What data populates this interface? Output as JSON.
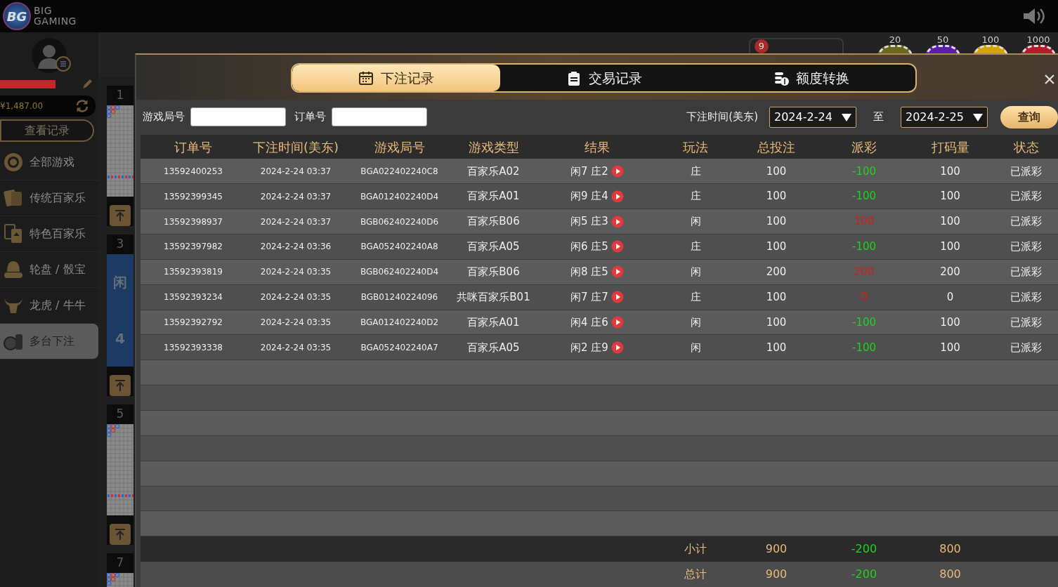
{
  "header": {
    "logo_badge": "BG",
    "logo_line1": "BIG",
    "logo_line2": "GAMING"
  },
  "sidebar": {
    "balance": "¥1,487.00",
    "history_button": "查看记录",
    "items": [
      {
        "label": "全部游戏",
        "kind": "chip",
        "selected": false
      },
      {
        "label": "传统百家乐",
        "kind": "cards",
        "selected": false
      },
      {
        "label": "特色百家乐",
        "kind": "spade",
        "selected": false
      },
      {
        "label": "轮盘 / 骰宝",
        "kind": "dice",
        "selected": false
      },
      {
        "label": "龙虎 / 牛牛",
        "kind": "bull",
        "selected": false
      },
      {
        "label": "多台下注",
        "kind": "stack",
        "selected": true
      }
    ]
  },
  "tables": [
    {
      "number": "1",
      "kind": "road"
    },
    {
      "number": "3",
      "kind": "result",
      "side": "闲",
      "score": "4"
    },
    {
      "number": "5",
      "kind": "road"
    },
    {
      "number": "7",
      "kind": "road"
    }
  ],
  "bet_rack": {
    "count": "9"
  },
  "chips": [
    {
      "label": "20",
      "color": "#6b6a1c"
    },
    {
      "label": "50",
      "color": "#5a1fa8"
    },
    {
      "label": "100",
      "color": "#d4a400"
    },
    {
      "label": "1000",
      "color": "#b51b2c"
    }
  ],
  "modal": {
    "tabs": [
      {
        "label": "下注记录",
        "kind": "calendar",
        "selected": true
      },
      {
        "label": "交易记录",
        "kind": "clipboard",
        "selected": false
      },
      {
        "label": "额度转换",
        "kind": "coins",
        "selected": false
      }
    ],
    "filters": {
      "round_label": "游戏局号",
      "order_label": "订单号",
      "time_label": "下注时间(美东)",
      "from": "2024-2-24",
      "to_label": "至",
      "to": "2024-2-25",
      "query_button": "查询"
    },
    "table": {
      "columns": [
        "订单号",
        "下注时间(美东)",
        "游戏局号",
        "游戏类型",
        "结果",
        "玩法",
        "总投注",
        "派彩",
        "打码量",
        "状态"
      ],
      "rows": [
        {
          "order": "13592400253",
          "time": "2024-2-24 03:37",
          "round": "BGA022402240C8",
          "game": "百家乐A02",
          "result": "闲7 庄2",
          "play": "庄",
          "bet": "100",
          "payout": {
            "value": "-100",
            "color": "#1ed41e"
          },
          "turnover": "100",
          "status": "已派彩"
        },
        {
          "order": "13592399345",
          "time": "2024-2-24 03:37",
          "round": "BGA012402240D4",
          "game": "百家乐A01",
          "result": "闲9 庄4",
          "play": "庄",
          "bet": "100",
          "payout": {
            "value": "-100",
            "color": "#1ed41e"
          },
          "turnover": "100",
          "status": "已派彩"
        },
        {
          "order": "13592398937",
          "time": "2024-2-24 03:37",
          "round": "BGB062402240D6",
          "game": "百家乐B06",
          "result": "闲5 庄3",
          "play": "闲",
          "bet": "100",
          "payout": {
            "value": "100",
            "color": "#d41e1e"
          },
          "turnover": "100",
          "status": "已派彩"
        },
        {
          "order": "13592397982",
          "time": "2024-2-24 03:36",
          "round": "BGA052402240A8",
          "game": "百家乐A05",
          "result": "闲6 庄5",
          "play": "庄",
          "bet": "100",
          "payout": {
            "value": "-100",
            "color": "#1ed41e"
          },
          "turnover": "100",
          "status": "已派彩"
        },
        {
          "order": "13592393819",
          "time": "2024-2-24 03:35",
          "round": "BGB062402240D4",
          "game": "百家乐B06",
          "result": "闲8 庄5",
          "play": "闲",
          "bet": "200",
          "payout": {
            "value": "200",
            "color": "#d41e1e"
          },
          "turnover": "200",
          "status": "已派彩"
        },
        {
          "order": "13592393234",
          "time": "2024-2-24 03:35",
          "round": "BGB01240224096",
          "game": "共咪百家乐B01",
          "result": "闲7 庄7",
          "play": "庄",
          "bet": "100",
          "payout": {
            "value": "0",
            "color": "#d41e1e"
          },
          "turnover": "0",
          "status": "已派彩"
        },
        {
          "order": "13592392792",
          "time": "2024-2-24 03:35",
          "round": "BGA012402240D2",
          "game": "百家乐A01",
          "result": "闲4 庄6",
          "play": "闲",
          "bet": "100",
          "payout": {
            "value": "-100",
            "color": "#1ed41e"
          },
          "turnover": "100",
          "status": "已派彩"
        },
        {
          "order": "13592393338",
          "time": "2024-2-24 03:35",
          "round": "BGA052402240A7",
          "game": "百家乐A05",
          "result": "闲2 庄9",
          "play": "闲",
          "bet": "100",
          "payout": {
            "value": "-100",
            "color": "#1ed41e"
          },
          "turnover": "100",
          "status": "已派彩"
        }
      ],
      "summary": [
        {
          "label": "小计",
          "bet": "900",
          "payout": {
            "value": "-200",
            "color": "#1ed41e"
          },
          "turnover": "800"
        },
        {
          "label": "总计",
          "bet": "900",
          "payout": {
            "value": "-200",
            "color": "#1ed41e"
          },
          "turnover": "800"
        }
      ]
    }
  }
}
